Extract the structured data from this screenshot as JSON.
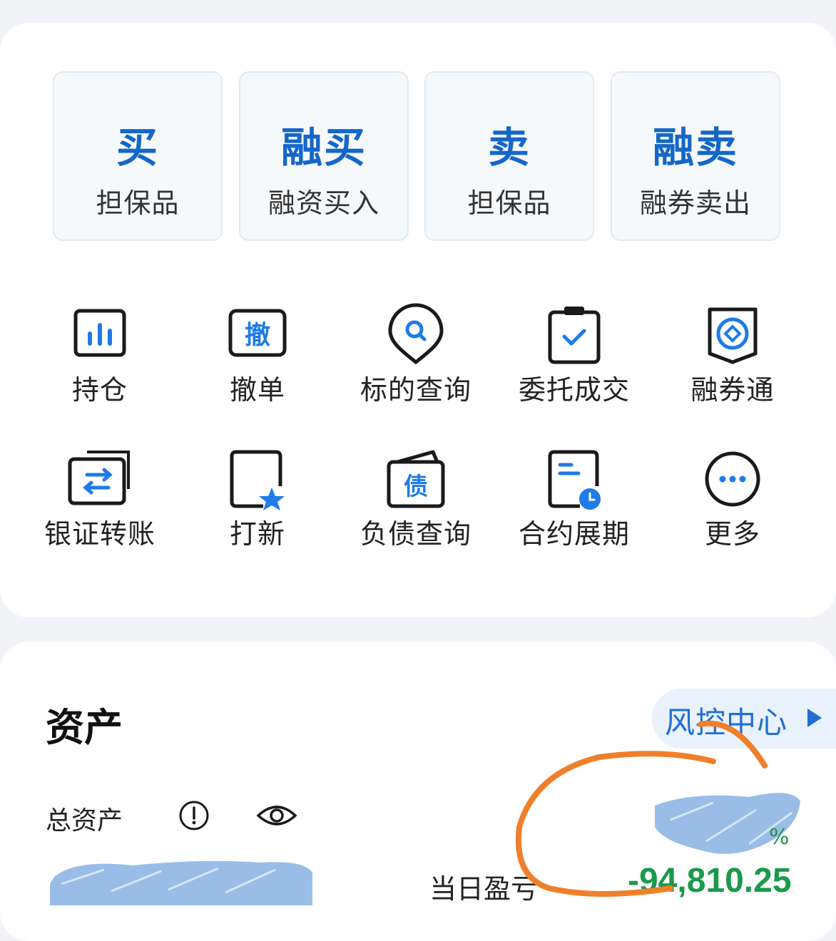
{
  "trade_buttons": [
    {
      "main": "买",
      "sub": "担保品"
    },
    {
      "main": "融买",
      "sub": "融资买入"
    },
    {
      "main": "卖",
      "sub": "担保品"
    },
    {
      "main": "融卖",
      "sub": "融券卖出"
    }
  ],
  "grid": [
    {
      "label": "持仓",
      "icon": "bar-chart-icon"
    },
    {
      "label": "撤单",
      "icon": "cancel-order-icon",
      "glyph": "撤"
    },
    {
      "label": "标的查询",
      "icon": "search-pin-icon"
    },
    {
      "label": "委托成交",
      "icon": "clipboard-check-icon"
    },
    {
      "label": "融券通",
      "icon": "coin-shield-icon"
    },
    {
      "label": "银证转账",
      "icon": "transfer-icon"
    },
    {
      "label": "打新",
      "icon": "ipo-star-icon"
    },
    {
      "label": "负债查询",
      "icon": "debt-icon",
      "glyph": "债"
    },
    {
      "label": "合约展期",
      "icon": "contract-clock-icon"
    },
    {
      "label": "更多",
      "icon": "more-icon"
    }
  ],
  "assets": {
    "title": "资产",
    "risk_center": "风控中心",
    "total_label": "总资产",
    "daily_pl_label": "当日盈亏",
    "daily_pl_value": "-94,810.25",
    "partial_percent_glyph": "%"
  },
  "colors": {
    "accent": "#1467c8",
    "loss_green": "#1b9a4a",
    "icon_blue": "#1e7be8",
    "redaction_blue": "#8eb6e3",
    "annotation_orange": "#f07f2a"
  }
}
